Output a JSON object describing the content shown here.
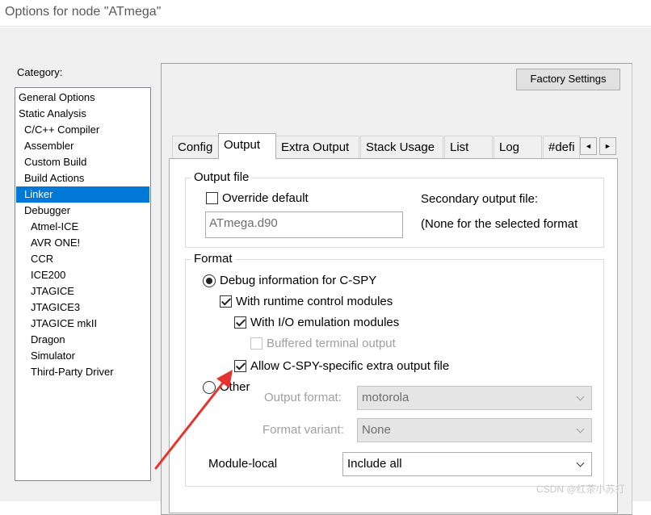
{
  "window": {
    "title": "Options for node \"ATmega\""
  },
  "category": {
    "label": "Category:",
    "items": [
      "General Options",
      "Static Analysis",
      "C/C++ Compiler",
      "Assembler",
      "Custom Build",
      "Build Actions",
      "Linker",
      "Debugger",
      "Atmel-ICE",
      "AVR ONE!",
      "CCR",
      "ICE200",
      "JTAGICE",
      "JTAGICE3",
      "JTAGICE mkII",
      "Dragon",
      "Simulator",
      "Third-Party Driver"
    ],
    "selected": "Linker"
  },
  "factory_settings_label": "Factory Settings",
  "tabs": [
    "Config",
    "Output",
    "Extra Output",
    "Stack Usage",
    "List",
    "Log",
    "#defi"
  ],
  "active_tab": "Output",
  "tab_scroll": {
    "left": "◄",
    "right": "►"
  },
  "output_file": {
    "title": "Output file",
    "override_default": {
      "label": "Override default",
      "checked": false
    },
    "filename": "ATmega.d90",
    "secondary_label": "Secondary output file:",
    "secondary_value": "(None for the selected format"
  },
  "format": {
    "title": "Format",
    "debug_info": {
      "label": "Debug information for C-SPY",
      "selected": true
    },
    "runtime_modules": {
      "label": "With runtime control modules",
      "checked": true
    },
    "io_emulation": {
      "label": "With I/O emulation modules",
      "checked": true
    },
    "buffered_terminal": {
      "label": "Buffered terminal output",
      "checked": false,
      "disabled": true
    },
    "allow_extra": {
      "label": "Allow C-SPY-specific extra output file",
      "checked": true
    },
    "other": {
      "label": "Other",
      "selected": false
    },
    "output_format": {
      "label": "Output format:",
      "value": "motorola"
    },
    "format_variant": {
      "label": "Format variant:",
      "value": "None"
    },
    "module_local": {
      "label": "Module-local",
      "value": "Include all"
    }
  },
  "watermark": "CSDN @红茶小苏打",
  "colors": {
    "selection": "#0078d7",
    "annotation_arrow": "#e8322d"
  }
}
